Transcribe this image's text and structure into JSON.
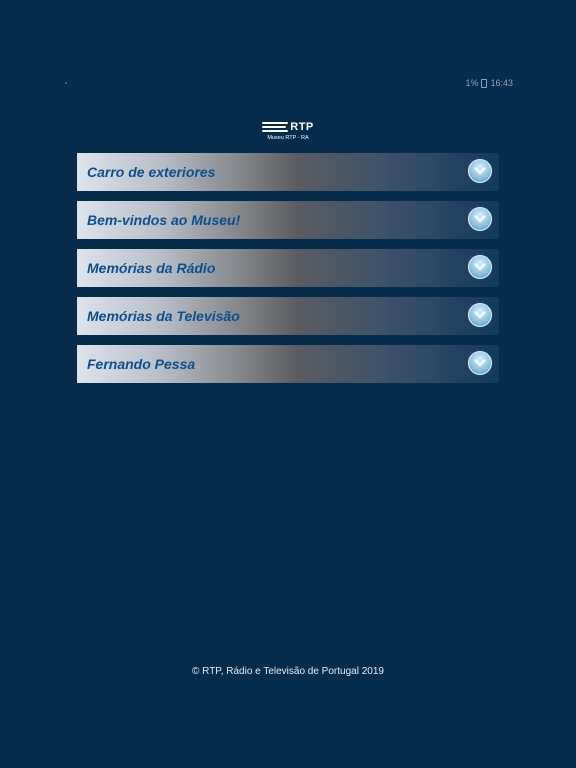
{
  "status_bar": {
    "battery": "1%",
    "time": "16:43"
  },
  "logo": {
    "brand": "RTP",
    "subtitle": "Museu RTP - RA"
  },
  "menu": {
    "items": [
      {
        "label": "Carro de exteriores"
      },
      {
        "label": "Bem-vindos ao Museu!"
      },
      {
        "label": "Memórias da Rádio"
      },
      {
        "label": "Memórias da Televisão"
      },
      {
        "label": "Fernando Pessa"
      }
    ]
  },
  "footer": {
    "text": "© RTP, Rádio e Televisão de Portugal 2019"
  },
  "colors": {
    "background": "#062c4b",
    "label": "#0e4e8c"
  },
  "icons": {
    "expand": "chevron-down-icon"
  }
}
